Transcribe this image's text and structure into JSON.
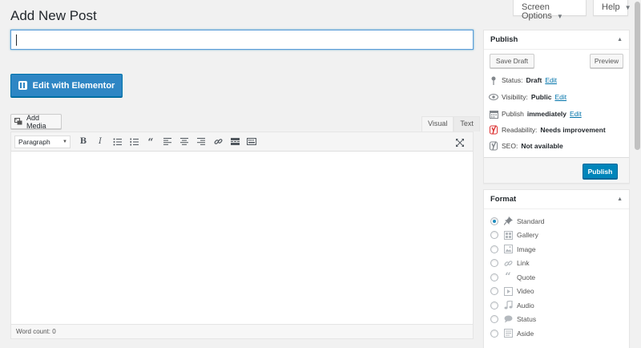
{
  "top_tabs": {
    "screen_options": "Screen Options",
    "help": "Help"
  },
  "page_title": "Add New Post",
  "title_input": {
    "value": ""
  },
  "elementor_button": "Edit with Elementor",
  "add_media": "Add Media",
  "editor_tabs": {
    "visual": "Visual",
    "text": "Text"
  },
  "toolbar": {
    "format_select": "Paragraph"
  },
  "word_count": "Word count: 0",
  "publish": {
    "title": "Publish",
    "save_draft": "Save Draft",
    "preview": "Preview",
    "status_label": "Status:",
    "status_value": "Draft",
    "visibility_label": "Visibility:",
    "visibility_value": "Public",
    "publish_label": "Publish",
    "publish_value": "immediately",
    "readability_label": "Readability:",
    "readability_value": "Needs improvement",
    "seo_label": "SEO:",
    "seo_value": "Not available",
    "edit": "Edit",
    "publish_button": "Publish"
  },
  "format": {
    "title": "Format",
    "items": [
      {
        "label": "Standard",
        "icon": "pin-icon",
        "checked": true
      },
      {
        "label": "Gallery",
        "icon": "gallery-icon",
        "checked": false
      },
      {
        "label": "Image",
        "icon": "image-icon",
        "checked": false
      },
      {
        "label": "Link",
        "icon": "link-icon",
        "checked": false
      },
      {
        "label": "Quote",
        "icon": "quote-icon",
        "checked": false
      },
      {
        "label": "Video",
        "icon": "video-icon",
        "checked": false
      },
      {
        "label": "Audio",
        "icon": "audio-icon",
        "checked": false
      },
      {
        "label": "Status",
        "icon": "status-icon",
        "checked": false
      },
      {
        "label": "Aside",
        "icon": "aside-icon",
        "checked": false
      }
    ]
  },
  "colors": {
    "primary": "#0085ba",
    "elementor": "#2e86c4",
    "link": "#0073aa",
    "yoast_bad": "#dc3232"
  }
}
